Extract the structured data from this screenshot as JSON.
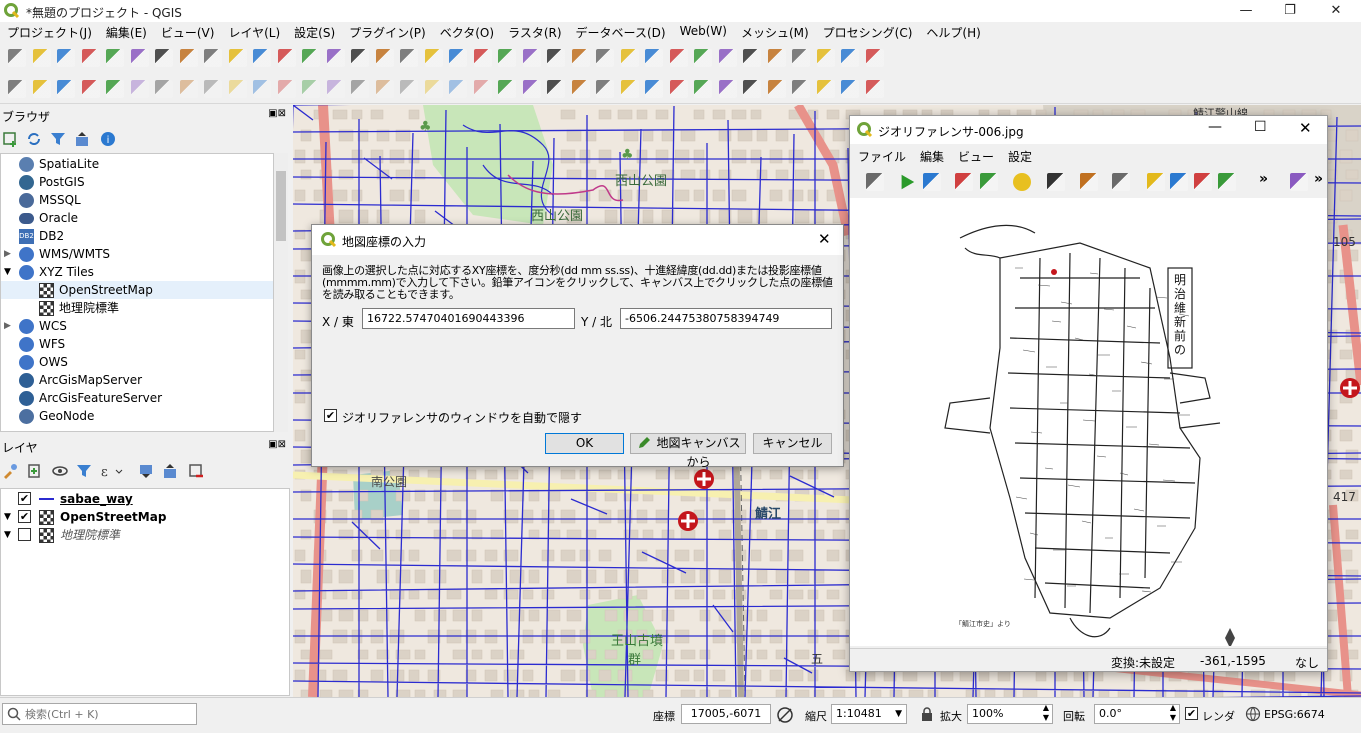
{
  "window": {
    "title": "*無題のプロジェクト - QGIS",
    "min": "—",
    "restore": "❐",
    "close": "✕"
  },
  "menu": [
    "プロジェクト(J)",
    "編集(E)",
    "ビュー(V)",
    "レイヤ(L)",
    "設定(S)",
    "プラグイン(P)",
    "ベクタ(O)",
    "ラスタ(R)",
    "データベース(D)",
    "Web(W)",
    "メッシュ(M)",
    "プロセシング(C)",
    "ヘルプ(H)"
  ],
  "browser": {
    "title": "ブラウザ",
    "items": [
      {
        "label": "SpatiaLite",
        "icon": "spatialite-icon",
        "color": "#5a7fb0"
      },
      {
        "label": "PostGIS",
        "icon": "postgis-elephant-icon",
        "color": "#336791"
      },
      {
        "label": "MSSQL",
        "icon": "mssql-icon",
        "color": "#4a6a9a"
      },
      {
        "label": "Oracle",
        "icon": "oracle-icon",
        "color": "#3c5a8c"
      },
      {
        "label": "DB2",
        "icon": "db2-icon",
        "color": "#3e6fb5"
      },
      {
        "label": "WMS/WMTS",
        "icon": "globe-icon",
        "color": "#3f74c8"
      },
      {
        "label": "XYZ Tiles",
        "icon": "globe-icon",
        "color": "#3f74c8"
      },
      {
        "label": "OpenStreetMap",
        "icon": "tile-grid-icon",
        "color": "#333"
      },
      {
        "label": "地理院標準",
        "icon": "tile-grid-icon",
        "color": "#333"
      },
      {
        "label": "WCS",
        "icon": "globe-icon",
        "color": "#3f74c8"
      },
      {
        "label": "WFS",
        "icon": "globe-icon",
        "color": "#3f74c8"
      },
      {
        "label": "OWS",
        "icon": "globe-icon",
        "color": "#3f74c8"
      },
      {
        "label": "ArcGisMapServer",
        "icon": "arcgis-globe-icon",
        "color": "#2e5f95"
      },
      {
        "label": "ArcGisFeatureServer",
        "icon": "arcgis-globe-icon",
        "color": "#2e5f95"
      },
      {
        "label": "GeoNode",
        "icon": "geonode-icon",
        "color": "#4c6fa0"
      }
    ]
  },
  "layers": {
    "title": "レイヤ",
    "items": [
      {
        "label": "sabae_way",
        "checked": true,
        "bold": true,
        "italic": false
      },
      {
        "label": "OpenStreetMap",
        "checked": true,
        "bold": true,
        "italic": false
      },
      {
        "label": "地理院標準",
        "checked": false,
        "bold": false,
        "italic": true
      }
    ]
  },
  "map_labels": {
    "nishiyama_park1": "西山公園",
    "nishiyama_park2": "西山公園",
    "minami_park": "南公園",
    "sabae": "鯖江",
    "ouyama_kofun1": "王山古墳",
    "ouyama_kofun2": "群",
    "road_top": "鯖江警山線",
    "num_105": "105",
    "num_417": "417",
    "five": "五"
  },
  "dialog": {
    "title": "地図座標の入力",
    "description": "画像上の選択した点に対応するXY座標を、度分秒(dd mm ss.ss)、十進経緯度(dd.dd)または投影座標値(mmmm.mm)で入力して下さい。鉛筆アイコンをクリックして、キャンバス上でクリックした点の座標値を読み取ることもできます。",
    "x_label": "X / 東",
    "x_value": "16722.57470401690443396",
    "y_label": "Y / 北",
    "y_value": "-6506.24475380758394749",
    "autohide_label": "ジオリファレンサのウィンドウを自動で隠す",
    "autohide_checked": true,
    "ok": "OK",
    "from_canvas": "地図キャンバスから",
    "cancel": "キャンセル"
  },
  "georef": {
    "title": "ジオリファレンサ-006.jpg",
    "menu": [
      "ファイル",
      "編集",
      "ビュー",
      "設定"
    ],
    "overflow": "»",
    "map_title": "明治維新前の鯖江図",
    "status_transform": "変換:未設定",
    "status_coords": "-361,-1595",
    "status_none": "なし"
  },
  "statusbar": {
    "search_placeholder": "検索(Ctrl + K)",
    "coord_label": "座標",
    "coord_value": "17005,-6071",
    "scale_label": "縮尺",
    "scale_value": "1:10481",
    "magnify_label": "拡大",
    "magnify_value": "100%",
    "rotation_label": "回転",
    "rotation_value": "0.0°",
    "render_label": "レンダ",
    "render_checked": true,
    "crs": "EPSG:6674"
  },
  "colors": {
    "road_blue": "#2b2bd0",
    "map_bg": "#efe8df",
    "park_green": "#c8e6b9",
    "primary_road": "#e8928a",
    "hospital_red": "#c4161c",
    "qgis_green": "#6fa33a"
  }
}
